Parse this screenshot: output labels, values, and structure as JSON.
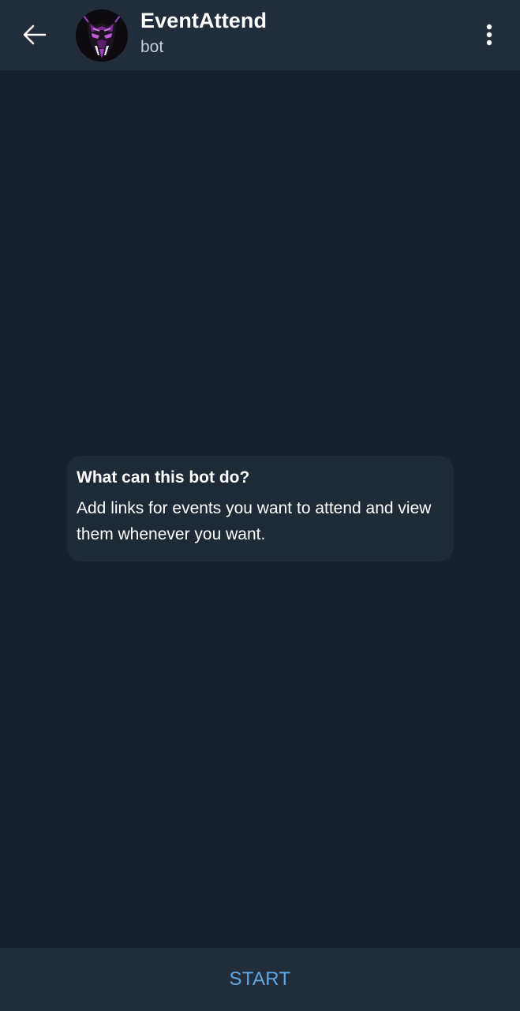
{
  "header": {
    "title": "EventAttend",
    "subtitle": "bot",
    "back_icon": "arrow-left-icon",
    "menu_icon": "more-vertical-icon",
    "avatar_icon": "bot-avatar"
  },
  "info_card": {
    "title": "What can this bot do?",
    "body": "Add links for events you want to attend and view them whenever you want."
  },
  "bottom": {
    "start_label": "START"
  },
  "colors": {
    "background": "#17202b",
    "header": "#222d3b",
    "card": "#1f2a37",
    "accent": "#5ea7e2",
    "avatar_accent": "#a23fc0"
  }
}
